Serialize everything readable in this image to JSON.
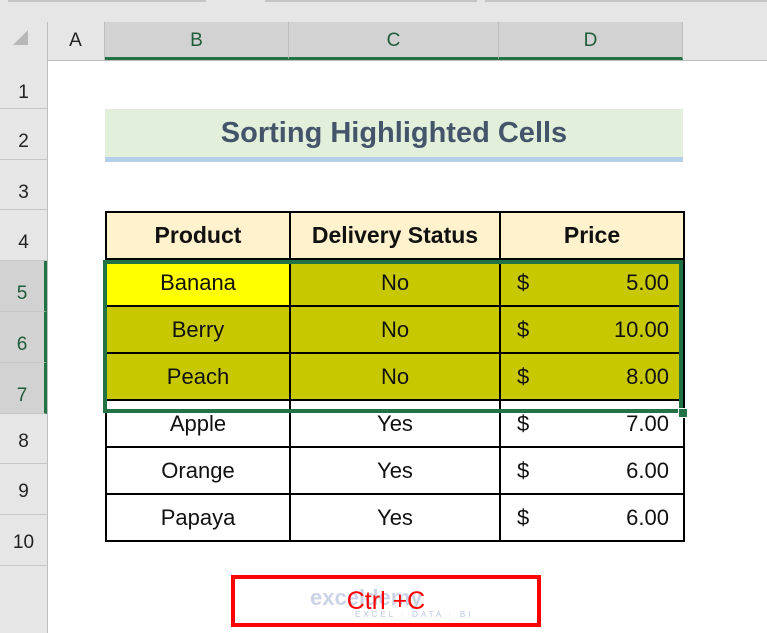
{
  "spreadsheet": {
    "column_headers": [
      "A",
      "B",
      "C",
      "D"
    ],
    "selected_columns": [
      "B",
      "C",
      "D"
    ],
    "row_headers": [
      "1",
      "2",
      "3",
      "4",
      "5",
      "6",
      "7",
      "8",
      "9",
      "10"
    ],
    "selected_rows": [
      "5",
      "6",
      "7"
    ]
  },
  "title": "Sorting Highlighted Cells",
  "table": {
    "headers": [
      "Product",
      "Delivery Status",
      "Price"
    ],
    "rows": [
      {
        "product": "Banana",
        "status": "No",
        "currency": "$",
        "price": "5.00",
        "highlight": "yellow+olive"
      },
      {
        "product": "Berry",
        "status": "No",
        "currency": "$",
        "price": "10.00",
        "highlight": "olive"
      },
      {
        "product": "Peach",
        "status": "No",
        "currency": "$",
        "price": "8.00",
        "highlight": "olive"
      },
      {
        "product": "Apple",
        "status": "Yes",
        "currency": "$",
        "price": "7.00",
        "highlight": "none"
      },
      {
        "product": "Orange",
        "status": "Yes",
        "currency": "$",
        "price": "6.00",
        "highlight": "none"
      },
      {
        "product": "Papaya",
        "status": "Yes",
        "currency": "$",
        "price": "6.00",
        "highlight": "none"
      }
    ]
  },
  "annotation": {
    "shortcut_label": "Ctrl +C"
  },
  "watermark": {
    "brand": "exceldemy",
    "tagline": "EXCEL · DATA · BI"
  },
  "colors": {
    "yellow_fill": "#ffff00",
    "olive_fill": "#c8c800",
    "header_fill": "#fff2cc",
    "title_fill": "#e2efda",
    "title_text": "#44546a",
    "selection_green": "#217346",
    "annotation_red": "#ff0000"
  }
}
